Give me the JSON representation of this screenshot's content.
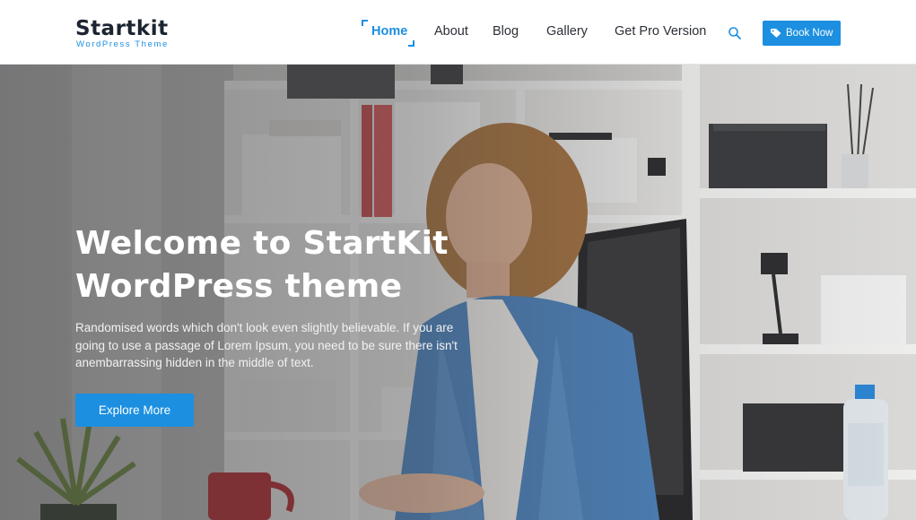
{
  "logo": {
    "name": "Startkit",
    "tagline": "WordPress Theme"
  },
  "nav": {
    "items": [
      {
        "label": "Home",
        "active": true
      },
      {
        "label": "About",
        "active": false
      },
      {
        "label": "Blog",
        "active": false
      },
      {
        "label": "Gallery",
        "active": false
      },
      {
        "label": "Get Pro Version",
        "active": false
      }
    ],
    "search_icon": "search-icon"
  },
  "header": {
    "book_label": "Book Now",
    "book_icon": "tag-icon"
  },
  "hero": {
    "title": "Welcome to StartKit WordPress theme",
    "description": "Randomised words which don't look even slightly believable. If you are going to use a passage of Lorem Ipsum, you need to be sure there isn't anembarrassing hidden in the middle of text.",
    "button_label": "Explore More"
  },
  "colors": {
    "accent": "#1c8fe0",
    "dark": "#1b2430",
    "header_bg": "#ffffff"
  }
}
